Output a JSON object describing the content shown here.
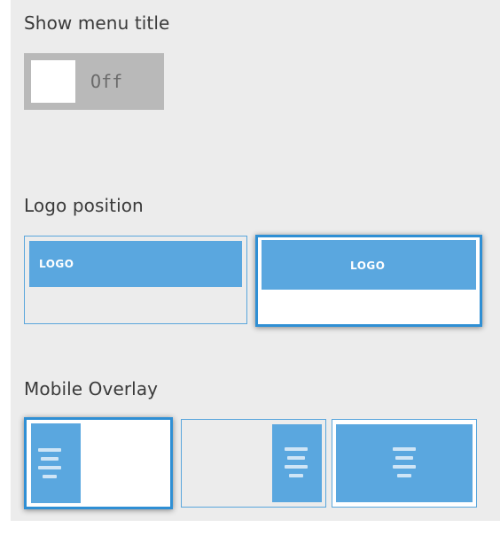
{
  "settings": {
    "show_menu_title": {
      "label": "Show menu title",
      "state": "Off"
    },
    "logo_position": {
      "label": "Logo position",
      "options": [
        {
          "id": "left",
          "logo_text": "LOGO",
          "selected": false
        },
        {
          "id": "center",
          "logo_text": "LOGO",
          "selected": true
        }
      ]
    },
    "mobile_overlay": {
      "label": "Mobile Overlay",
      "options": [
        {
          "id": "left-panel",
          "selected": true
        },
        {
          "id": "right-panel",
          "selected": false
        },
        {
          "id": "full-screen",
          "selected": false
        }
      ]
    }
  },
  "colors": {
    "accent": "#2f8fd4",
    "tile_blue": "#5aa7df",
    "panel_bg": "#ececec",
    "toggle_off": "#b9b9b9"
  },
  "icons": [
    "hamburger-menu-icon"
  ]
}
